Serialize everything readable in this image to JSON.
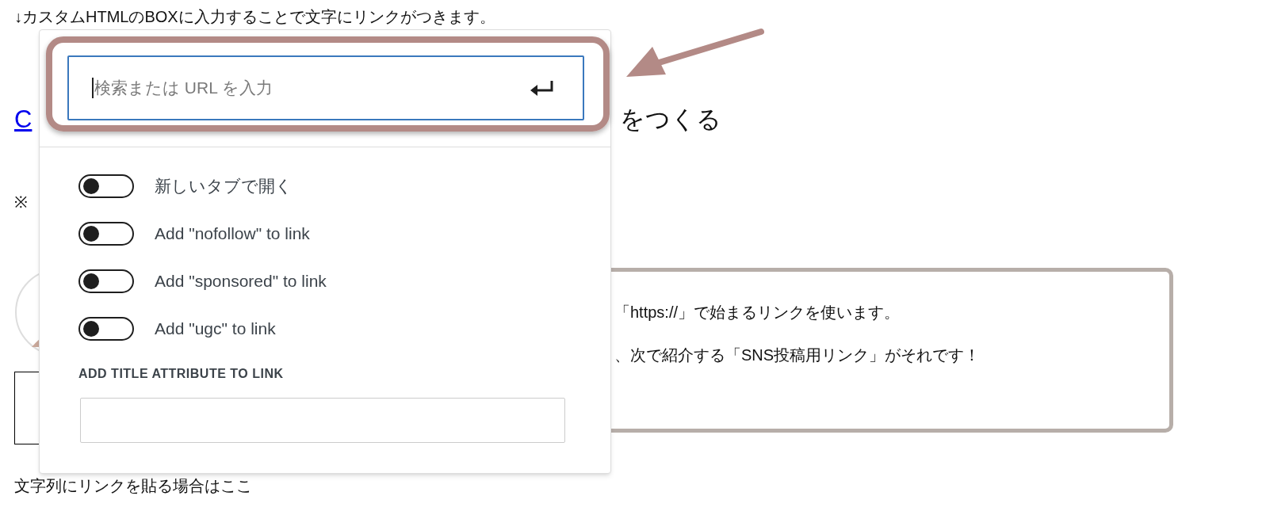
{
  "article": {
    "intro_text": "↓カスタムHTMLのBOXに入力することで文字にリンクがつきます。",
    "heading_link": "C",
    "heading_text": "をつくる",
    "note_mark": "※",
    "callout_lines": [
      "「https://」で始まるリンクを使います。",
      "、次で紹介する「SNS投稿用リンク」がそれです！"
    ],
    "footer_text": "文字列にリンクを貼る場合はここ"
  },
  "link_popover": {
    "url_field": {
      "placeholder": "検索または URL を入力"
    },
    "options": [
      {
        "label": "新しいタブで開く",
        "on": false
      },
      {
        "label": "Add \"nofollow\" to link",
        "on": false
      },
      {
        "label": "Add \"sponsored\" to link",
        "on": false
      },
      {
        "label": "Add \"ugc\" to link",
        "on": false
      }
    ],
    "title_attribute": {
      "label": "ADD TITLE ATTRIBUTE TO LINK"
    }
  }
}
